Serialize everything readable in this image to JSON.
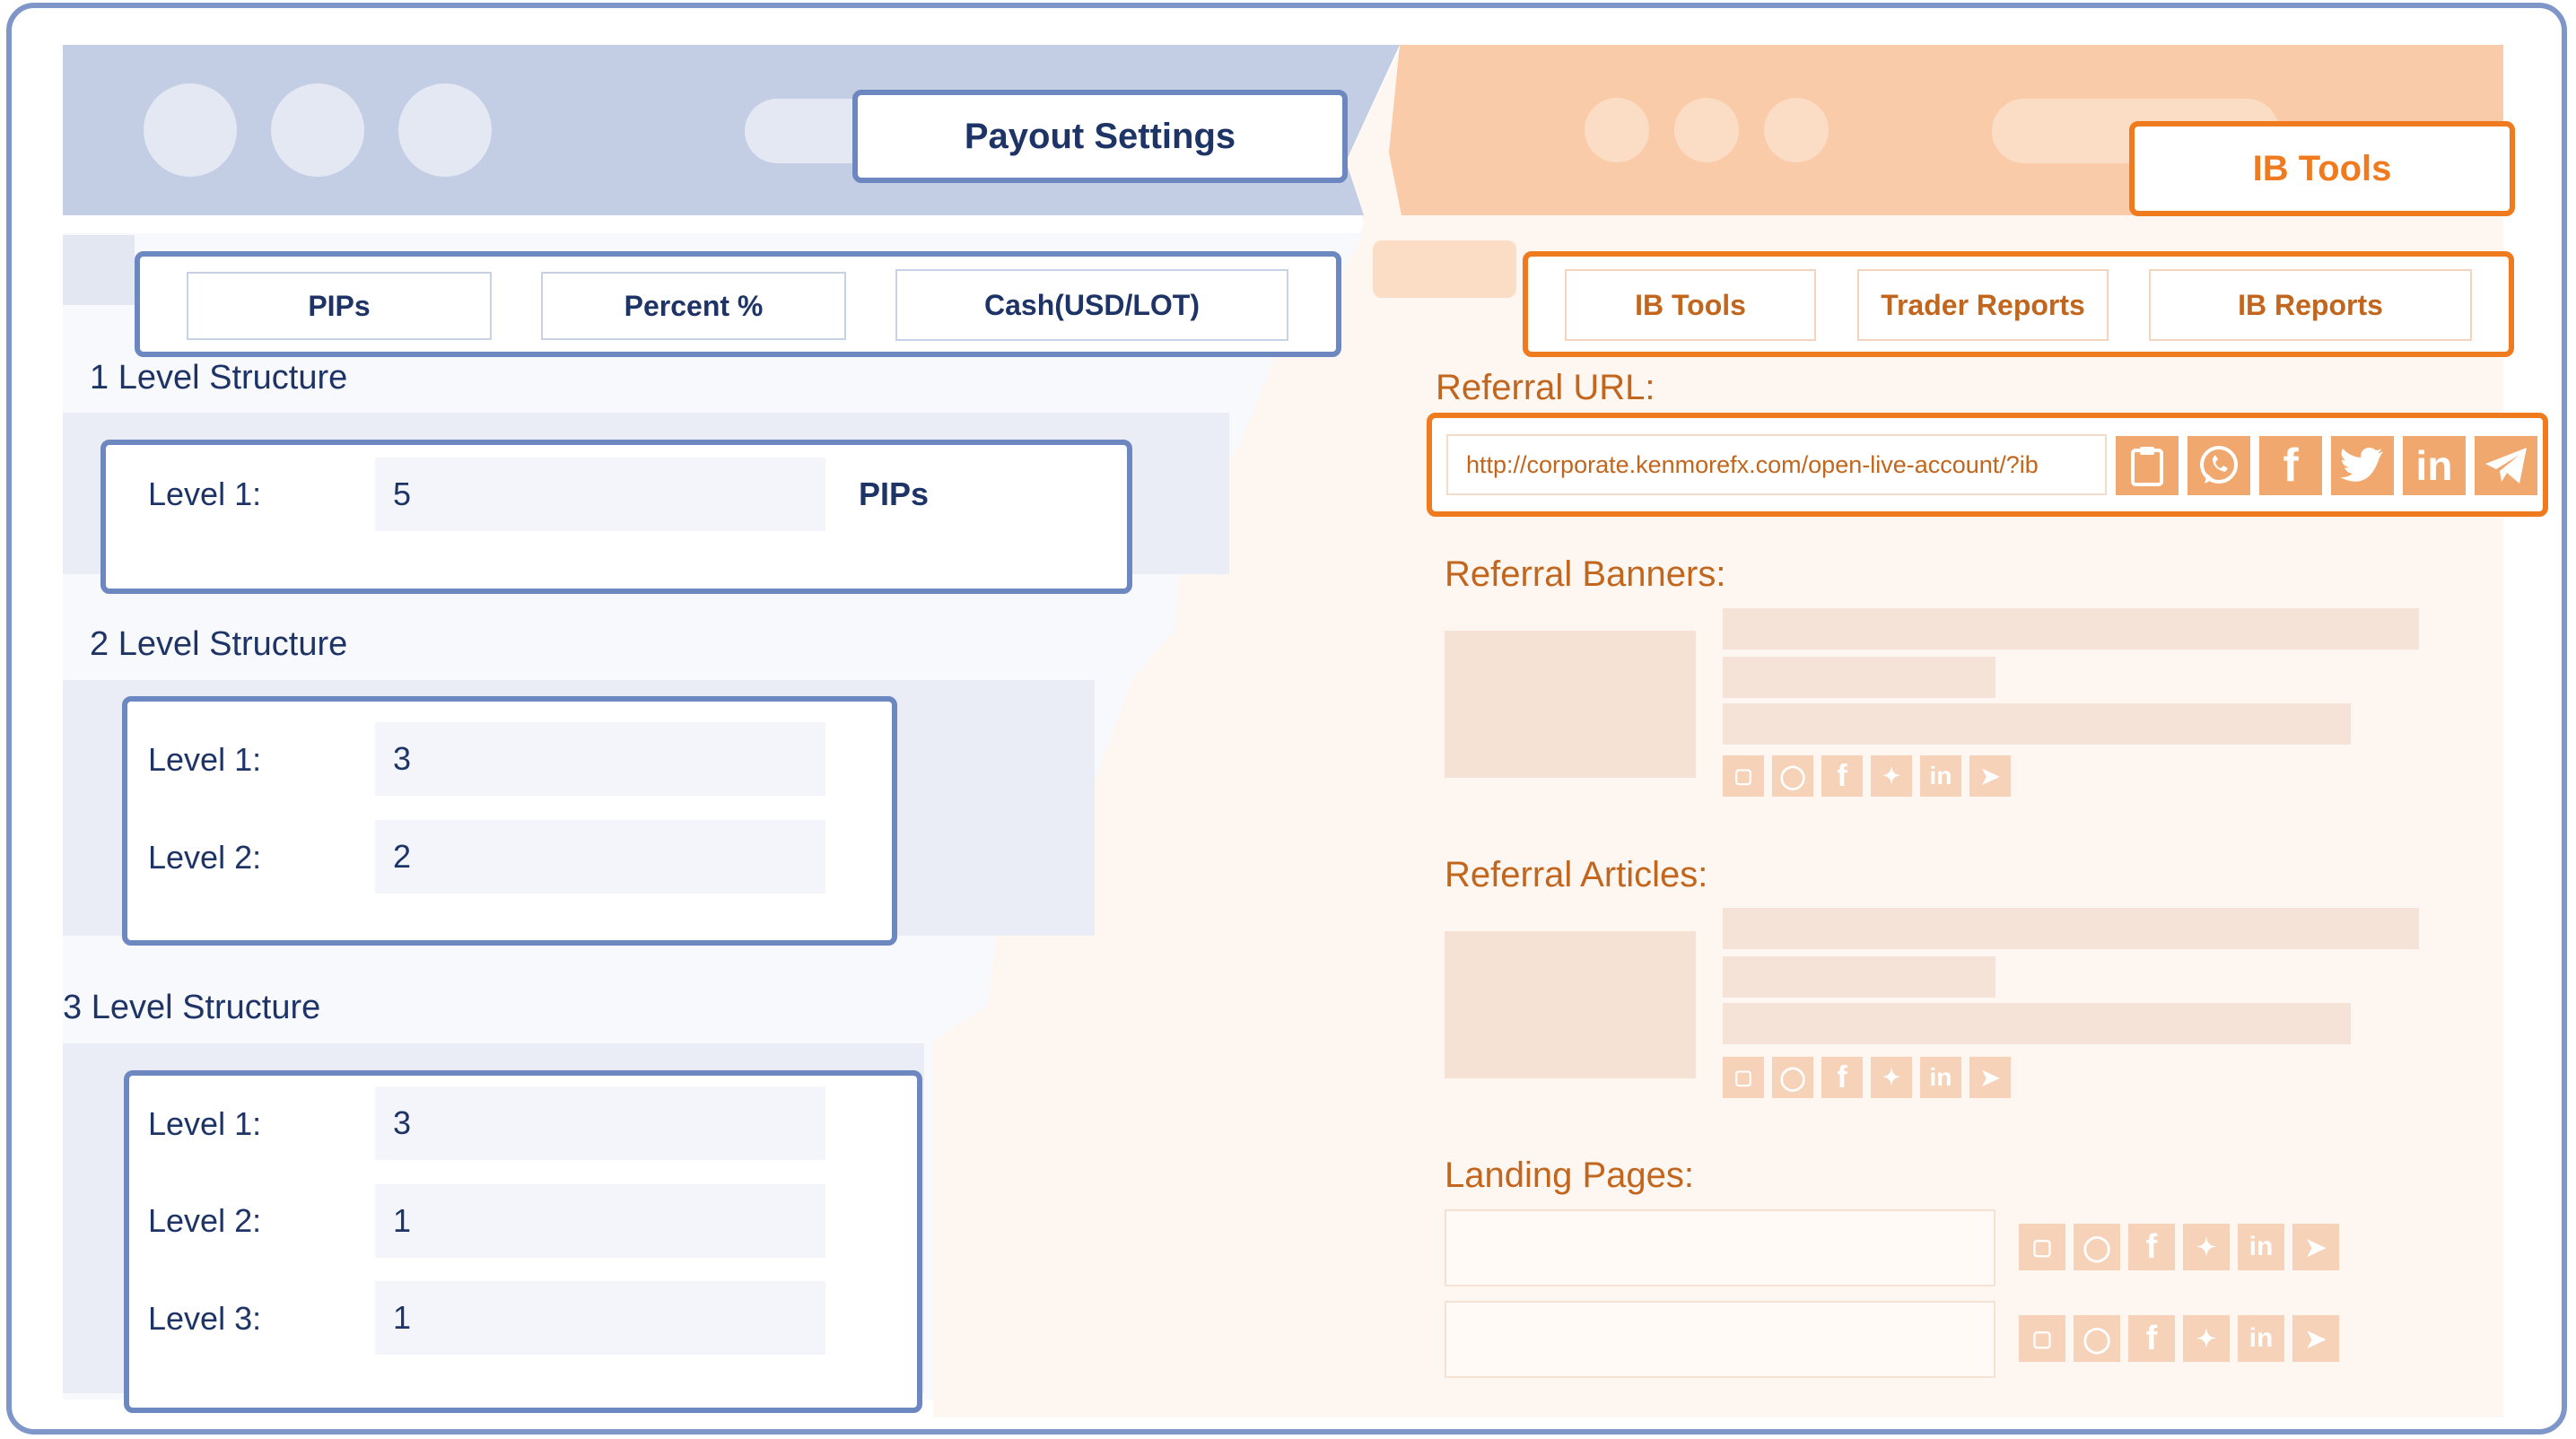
{
  "payout": {
    "title": "Payout Settings",
    "tabs": [
      "PIPs",
      "Percent %",
      "Cash(USD/LOT)"
    ],
    "structures": [
      {
        "label": "1 Level Structure",
        "unit": "PIPs",
        "levels": [
          {
            "label": "Level 1:",
            "value": "5"
          }
        ]
      },
      {
        "label": "2 Level Structure",
        "levels": [
          {
            "label": "Level 1:",
            "value": "3"
          },
          {
            "label": "Level 2:",
            "value": "2"
          }
        ]
      },
      {
        "label": "3 Level Structure",
        "levels": [
          {
            "label": "Level 1:",
            "value": "3"
          },
          {
            "label": "Level 2:",
            "value": "1"
          },
          {
            "label": "Level 3:",
            "value": "1"
          }
        ]
      }
    ]
  },
  "ib_tools": {
    "title": "IB Tools",
    "tabs": [
      "IB Tools",
      "Trader Reports",
      "IB Reports"
    ],
    "referral_url_label": "Referral URL:",
    "referral_url": "http://corporate.kenmorefx.com/open-live-account/?ib",
    "referral_banners_label": "Referral Banners:",
    "referral_articles_label": "Referral Articles:",
    "landing_pages_label": "Landing Pages:",
    "share_icons": [
      "clipboard-icon",
      "whatsapp-icon",
      "facebook-icon",
      "twitter-icon",
      "linkedin-icon",
      "telegram-icon"
    ]
  },
  "colors": {
    "blue_accent": "#6d87c0",
    "blue_text": "#1e3466",
    "orange_accent": "#f07b1f",
    "orange_text": "#c2661d",
    "orange_icon_bg": "#f0a86e",
    "orange_icon_faint": "#f6d2b9"
  }
}
